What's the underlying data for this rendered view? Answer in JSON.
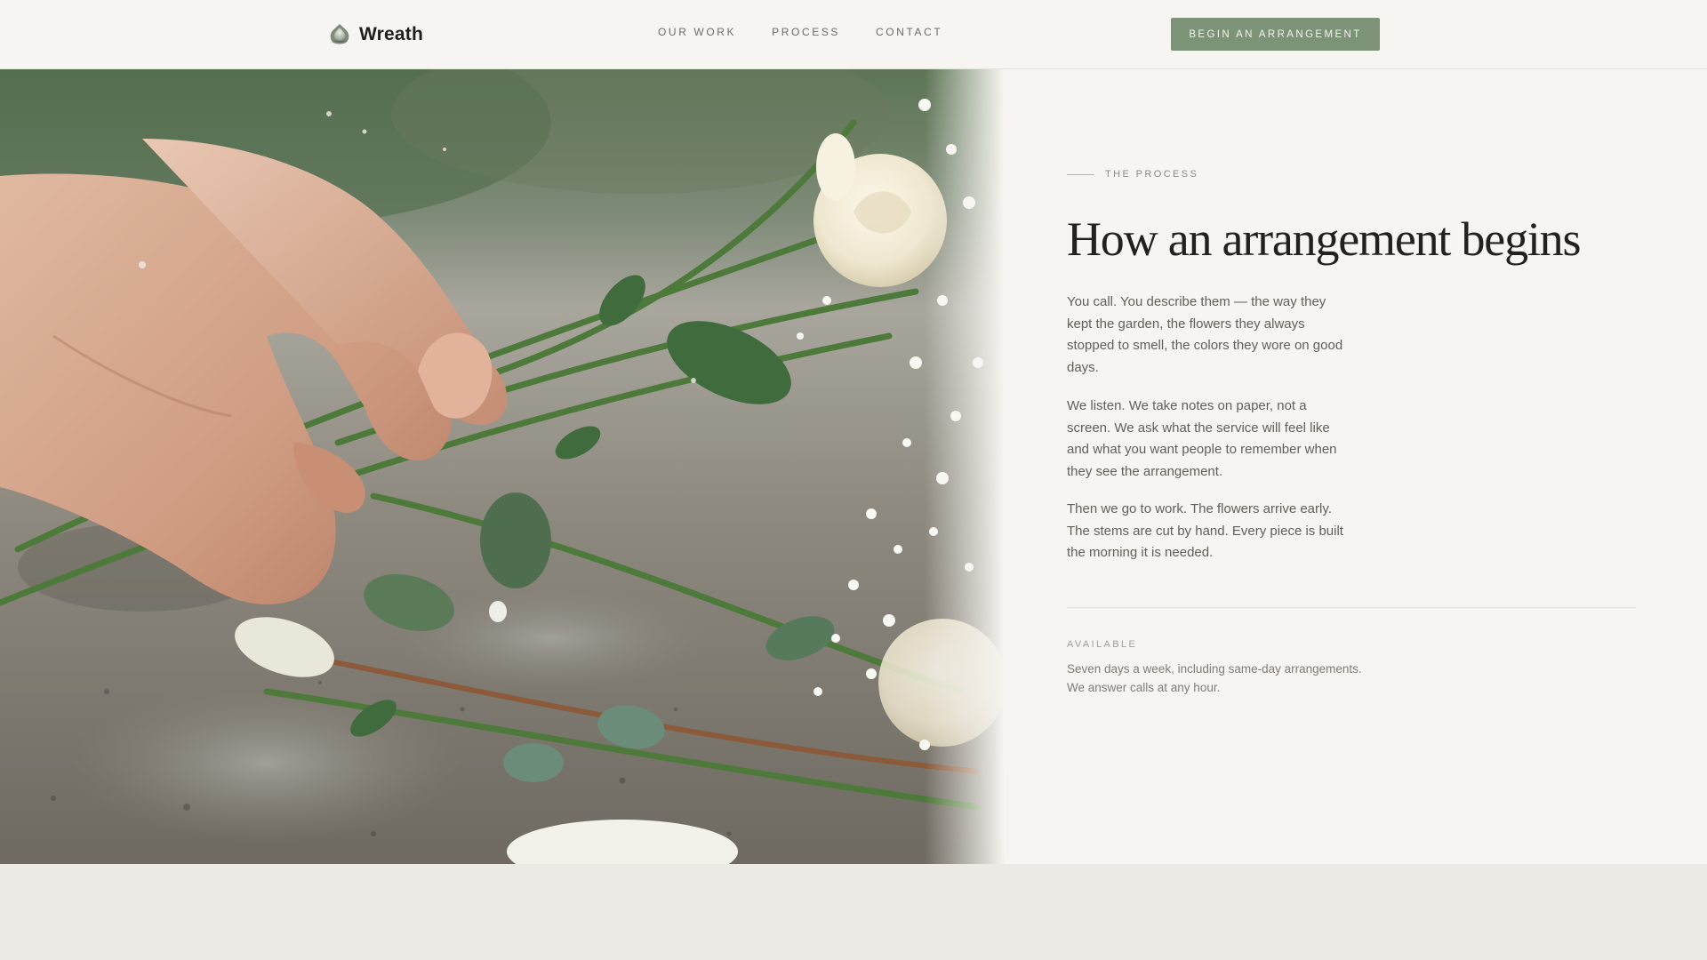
{
  "header": {
    "brand": {
      "name": "Wreath",
      "icon": "lotus-wreath-icon"
    },
    "nav": [
      {
        "label": "OUR WORK"
      },
      {
        "label": "PROCESS"
      },
      {
        "label": "CONTACT"
      }
    ],
    "cta_label": "BEGIN AN ARRANGEMENT"
  },
  "hero": {
    "image": "hands arranging roses, baby's breath and eucalyptus on stone"
  },
  "process": {
    "eyebrow": "THE PROCESS",
    "title": "How an arrangement begins",
    "paragraphs": [
      "You call. You describe them — the way they kept the garden, the flowers they always stopped to smell, the colors they wore on good days.",
      "We listen. We take notes on paper, not a screen. We ask what the service will feel like and what you want people to remember when they see the arrangement.",
      "Then we go to work. The flowers arrive early. The stems are cut by hand. Every piece is built the morning it is needed."
    ],
    "availability": {
      "label": "AVAILABLE",
      "lines": [
        "Seven days a week, including same-day arrangements.",
        "We answer calls at any hour."
      ]
    }
  },
  "colors": {
    "accent": "#7d9378",
    "background": "#f7f5f1",
    "band": "#ede9e5",
    "heading": "#22211e",
    "body_text": "#625f58"
  }
}
